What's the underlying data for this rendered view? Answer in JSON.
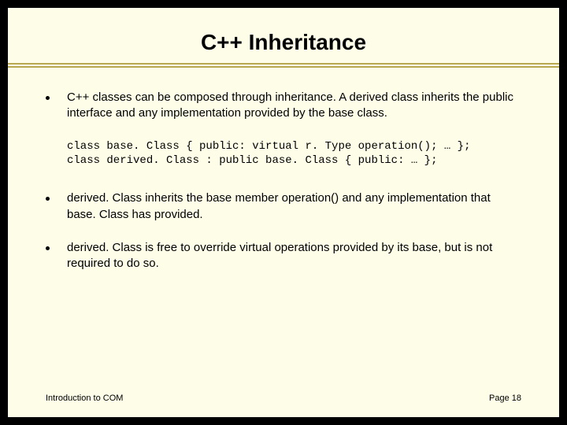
{
  "title": "C++ Inheritance",
  "bullets": [
    "C++ classes can be composed through inheritance. A derived class inherits the public interface and any implementation provided by the base class.",
    "derived. Class inherits the base member operation() and any implementation that base. Class has provided.",
    "derived. Class is free to override virtual operations provided by its base, but is not required to do so."
  ],
  "code": "class base. Class { public: virtual r. Type operation(); … };\nclass derived. Class : public base. Class { public: … };",
  "footer": {
    "left": "Introduction to COM",
    "right": "Page 18"
  }
}
